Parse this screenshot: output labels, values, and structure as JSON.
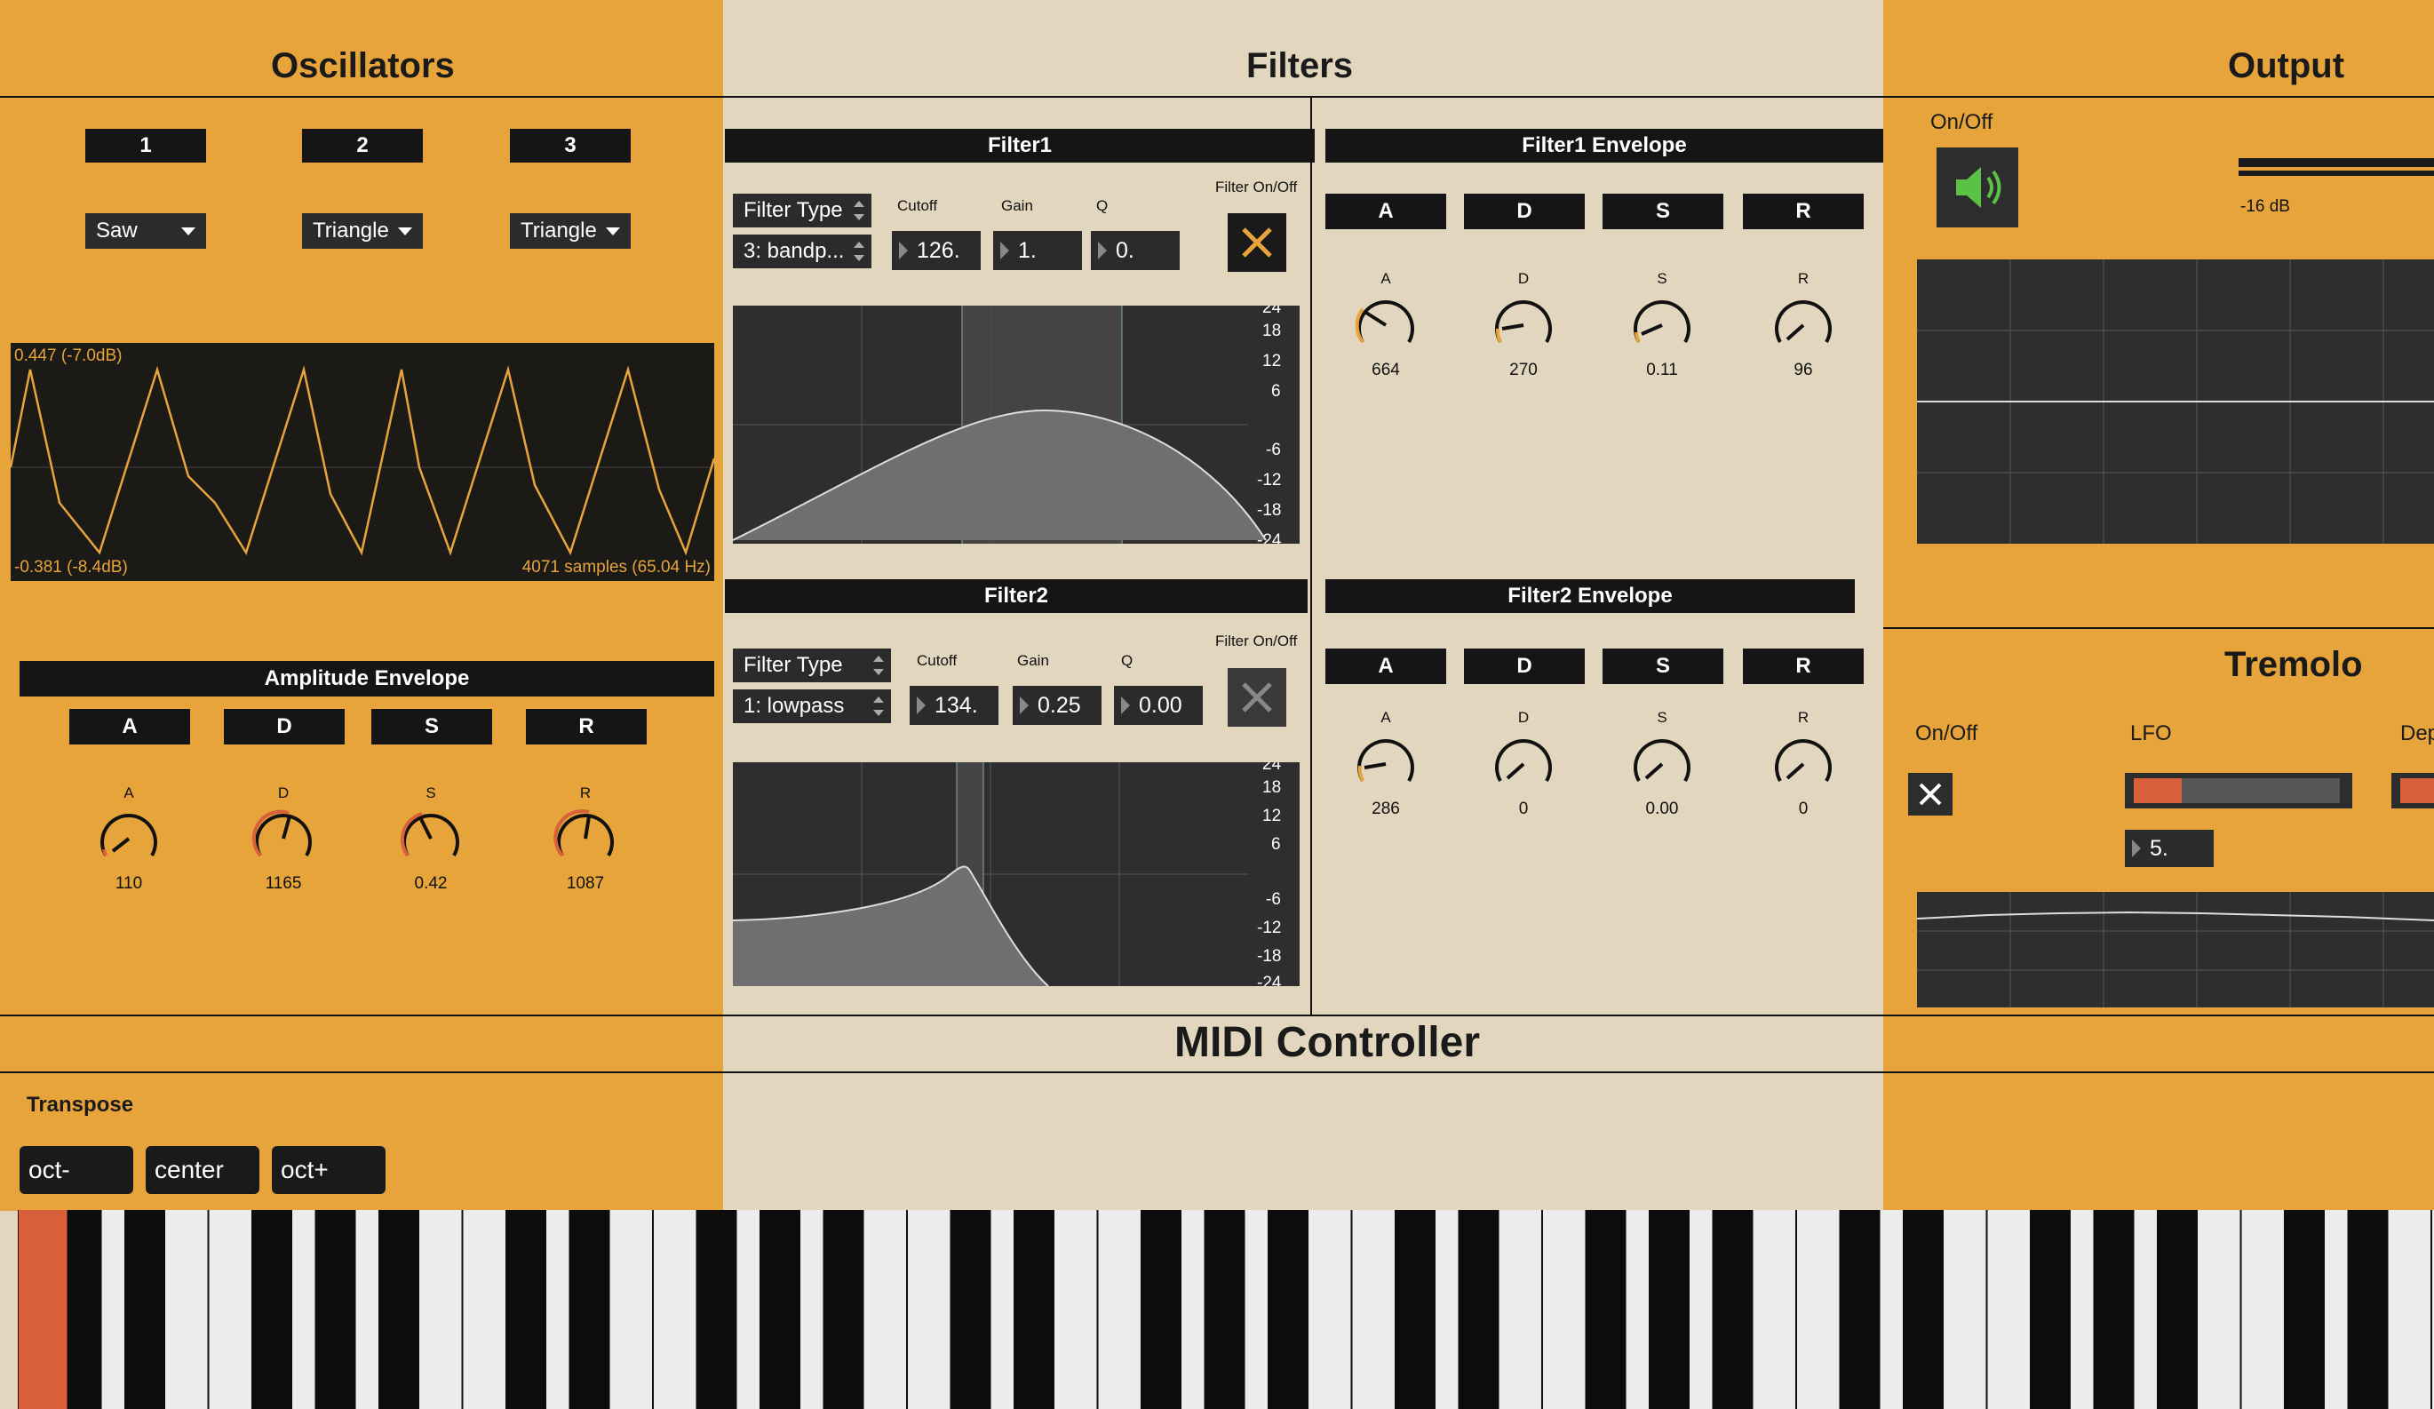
{
  "sections": {
    "oscillators": "Oscillators",
    "filters": "Filters",
    "output": "Output",
    "tremolo": "Tremolo",
    "midi": "MIDI Controller"
  },
  "oscillators": {
    "tabs": [
      "1",
      "2",
      "3"
    ],
    "waveforms": [
      "Saw",
      "Triangle",
      "Triangle"
    ],
    "scope": {
      "max_label": "0.447 (-7.0dB)",
      "min_label": "-0.381 (-8.4dB)",
      "info_label": "4071 samples (65.04 Hz)"
    }
  },
  "amp_env": {
    "title": "Amplitude Envelope",
    "tabs": [
      "A",
      "D",
      "S",
      "R"
    ],
    "knob_labels": [
      "A",
      "D",
      "S",
      "R"
    ],
    "knob_values": [
      "110",
      "1165",
      "0.42",
      "1087"
    ]
  },
  "filter1": {
    "title": "Filter1",
    "type_label": "Filter Type",
    "type_value": "3: bandp...",
    "cutoff_label": "Cutoff",
    "gain_label": "Gain",
    "q_label": "Q",
    "cutoff": "126.",
    "gain": "1.",
    "q": "0.",
    "onoff_label": "Filter On/Off",
    "db_ticks": [
      "24",
      "18",
      "12",
      "6",
      "-6",
      "-12",
      "-18",
      "-24"
    ]
  },
  "filter2": {
    "title": "Filter2",
    "type_label": "Filter Type",
    "type_value": "1: lowpass",
    "cutoff_label": "Cutoff",
    "gain_label": "Gain",
    "q_label": "Q",
    "cutoff": "134.",
    "gain": "0.25",
    "q": "0.00",
    "onoff_label": "Filter On/Off",
    "db_ticks": [
      "24",
      "18",
      "12",
      "6",
      "-6",
      "-12",
      "-18",
      "-24"
    ]
  },
  "filter1_env": {
    "title": "Filter1 Envelope",
    "tabs": [
      "A",
      "D",
      "S",
      "R"
    ],
    "knob_labels": [
      "A",
      "D",
      "S",
      "R"
    ],
    "knob_values": [
      "664",
      "270",
      "0.11",
      "96"
    ]
  },
  "filter2_env": {
    "title": "Filter2 Envelope",
    "tabs": [
      "A",
      "D",
      "S",
      "R"
    ],
    "knob_labels": [
      "A",
      "D",
      "S",
      "R"
    ],
    "knob_values": [
      "286",
      "0",
      "0.00",
      "0"
    ]
  },
  "output": {
    "onoff_label": "On/Off",
    "level_label": "-16 dB"
  },
  "tremolo": {
    "onoff_label": "On/Off",
    "lfo_label": "LFO",
    "depth_label": "Dep",
    "lfo_value": "5."
  },
  "midi": {
    "transpose_label": "Transpose",
    "buttons": [
      "oct-",
      "center",
      "oct+"
    ]
  },
  "colors": {
    "orange_panel": "#E6A43A",
    "beige_panel": "#E2D6BE",
    "accent": "#D9603A",
    "dark": "#151515"
  }
}
